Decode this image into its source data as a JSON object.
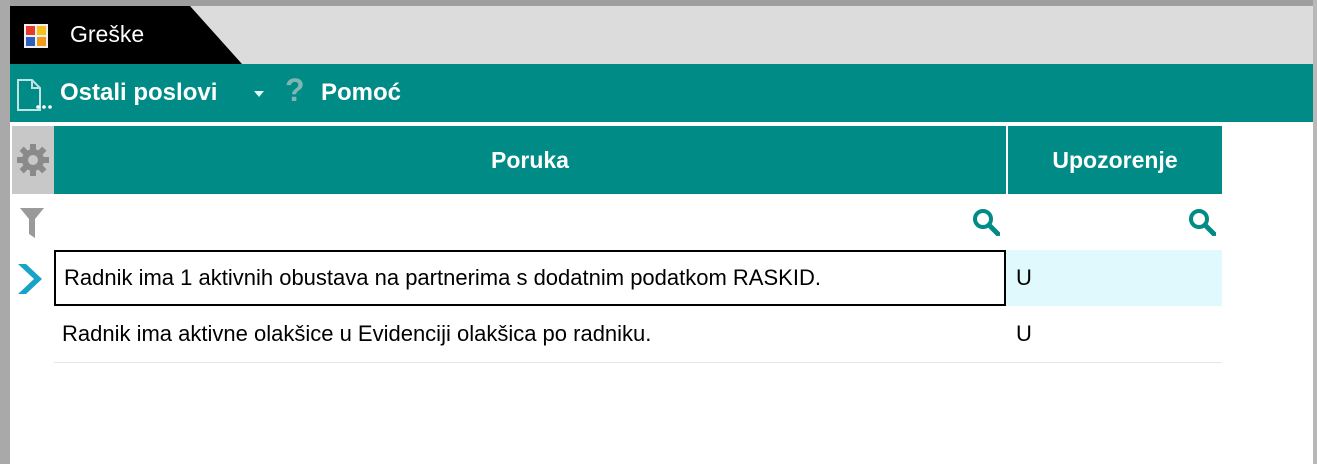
{
  "window": {
    "tab_title": "Greške"
  },
  "toolbar": {
    "other_jobs_label": "Ostali poslovi",
    "help_label": "Pomoć"
  },
  "grid": {
    "columns": [
      {
        "label": "Poruka"
      },
      {
        "label": "Upozorenje"
      }
    ],
    "rows": [
      {
        "poruka": "Radnik ima 1 aktivnih obustava na partnerima s dodatnim podatkom RASKID.",
        "upozorenje": "U",
        "selected": true
      },
      {
        "poruka": "Radnik ima aktivne olakšice u Evidenciji olakšica po radniku.",
        "upozorenje": "U",
        "selected": false
      }
    ]
  },
  "colors": {
    "accent": "#008b86",
    "selected_row": "#dff9fd",
    "indicator": "#17a3c8"
  }
}
